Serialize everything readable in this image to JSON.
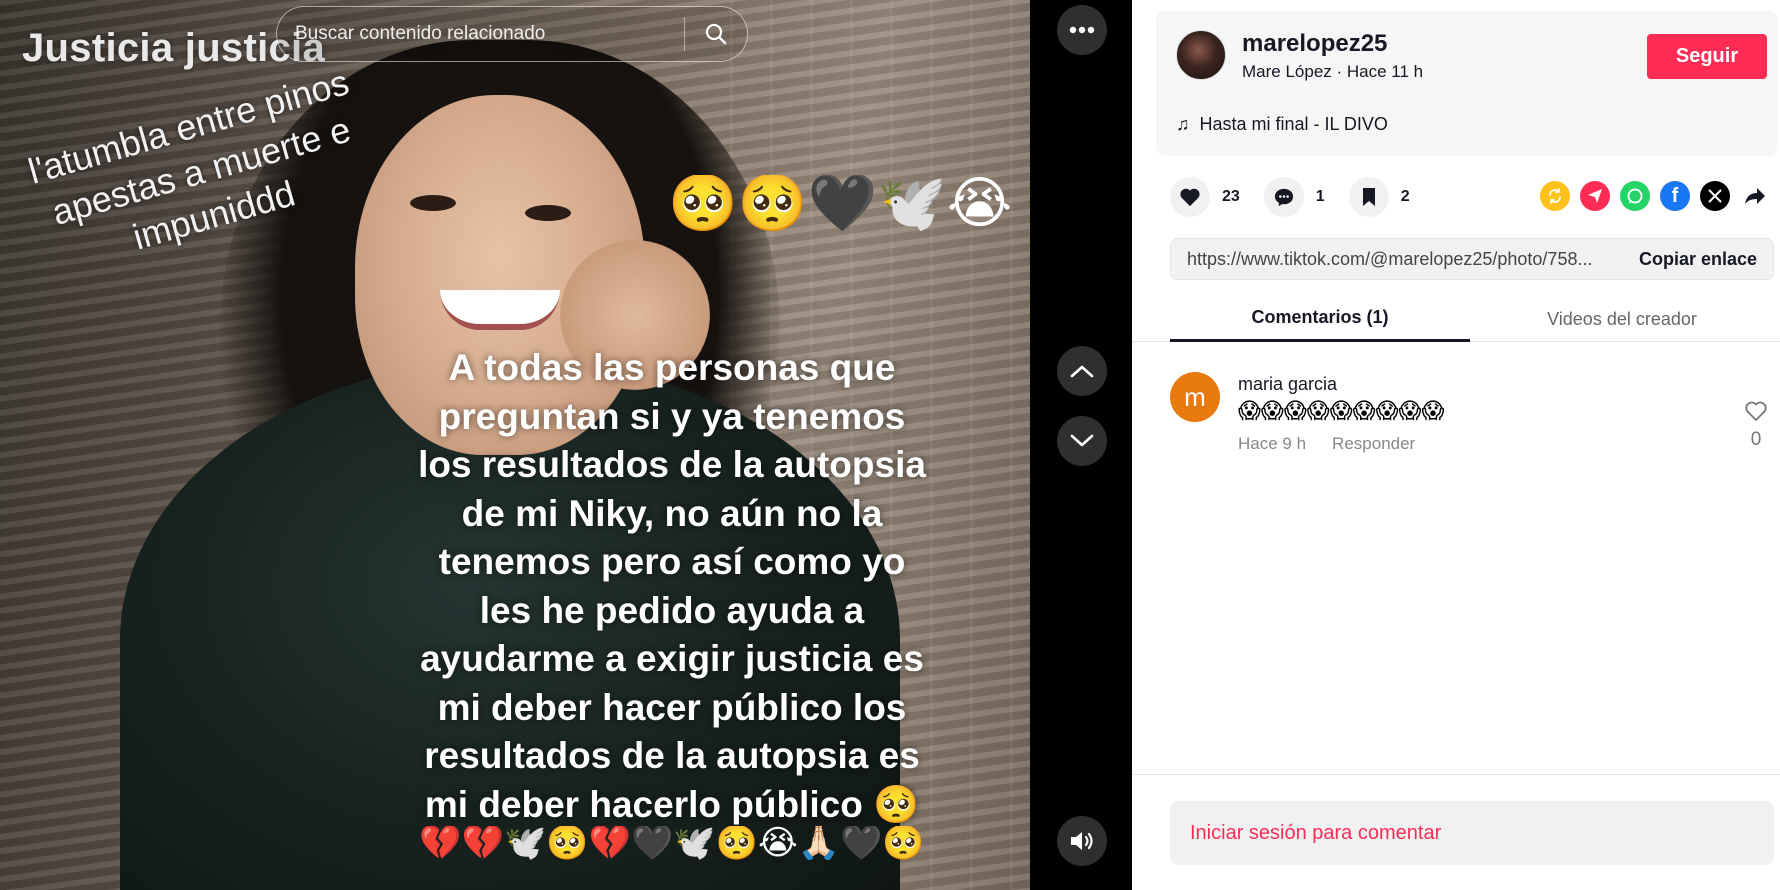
{
  "video": {
    "overlay_title": "Justicia justicia",
    "slanted_text": [
      "l'atumbla entre pinos",
      "apestas a muerte e",
      "impuniddd"
    ],
    "emoji_row": "🥺🥺🖤🕊️😭",
    "caption_lines": [
      "A todas las personas que",
      "preguntan si y ya tenemos",
      "los resultados de la autopsia",
      "de mi Niky, no aún no la",
      "tenemos pero así como yo",
      "les he pedido ayuda a",
      "ayudarme a exigir justicia es",
      "mi deber hacer público los",
      "resultados de la autopsia es",
      "mi deber hacerlo público 🥺"
    ],
    "caption_emoji": "💔💔🕊️🥺💔🖤🕊️🥺😭🙏🏻🖤🥺"
  },
  "search": {
    "placeholder": "Buscar contenido relacionado"
  },
  "author": {
    "username": "marelopez25",
    "subtitle": "Mare López · Hace 11 h",
    "follow_label": "Seguir",
    "music": "Hasta mi final - IL DIVO"
  },
  "stats": {
    "likes": "23",
    "comments": "1",
    "saves": "2"
  },
  "link": {
    "url": "https://www.tiktok.com/@marelopez25/photo/758...",
    "copy_label": "Copiar enlace"
  },
  "tabs": [
    {
      "label": "Comentarios (1)",
      "active": true
    },
    {
      "label": "Videos del creador",
      "active": false
    }
  ],
  "comments": [
    {
      "avatar_letter": "m",
      "username": "maria garcia",
      "text": "😱😱😱😱😱😱😱😱😱",
      "time": "Hace 9 h",
      "reply_label": "Responder",
      "likes": "0"
    }
  ],
  "login_label": "Iniciar sesión para comentar",
  "colors": {
    "accent": "#fe2c55",
    "comment_avatar": "#e8790d"
  },
  "icons": {
    "share": [
      "repost-icon",
      "send-icon",
      "whatsapp-icon",
      "facebook-icon",
      "x-icon",
      "share-arrow-icon"
    ]
  }
}
